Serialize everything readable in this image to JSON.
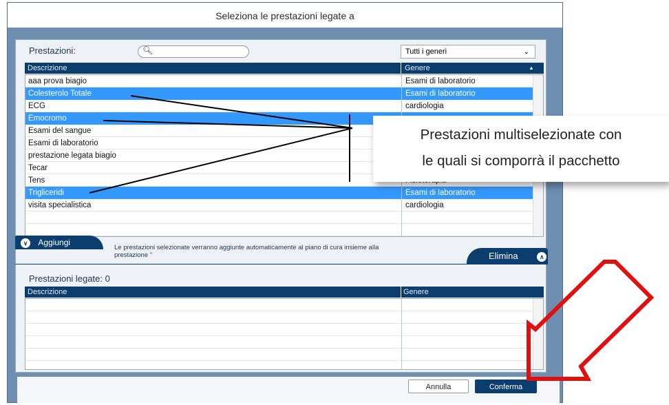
{
  "window": {
    "title": "Seleziona le prestazioni legate a"
  },
  "top": {
    "label": "Prestazioni:",
    "search_value": "",
    "filter_value": "Tutti i generi",
    "columns": [
      "Descrizione",
      "Genere"
    ],
    "sort_indicator": "▲",
    "rows": [
      {
        "descrizione": "aaa prova biagio",
        "genere": "Esami di laboratorio",
        "selected": false
      },
      {
        "descrizione": "Colesterolo Totale",
        "genere": "Esami di laboratorio",
        "selected": true
      },
      {
        "descrizione": "ECG",
        "genere": "cardiologia",
        "selected": false
      },
      {
        "descrizione": "Emocromo",
        "genere": "",
        "selected": true
      },
      {
        "descrizione": "Esami del sangue",
        "genere": "",
        "selected": false
      },
      {
        "descrizione": "Esami di laboratorio",
        "genere": "",
        "selected": false
      },
      {
        "descrizione": "prestazione legata biagio",
        "genere": "",
        "selected": false
      },
      {
        "descrizione": "Tecar",
        "genere": "",
        "selected": false
      },
      {
        "descrizione": "Tens",
        "genere": "Fisioterapia",
        "selected": false
      },
      {
        "descrizione": "Trigliceridi",
        "genere": "Esami di laboratorio",
        "selected": true
      },
      {
        "descrizione": "visita specialistica",
        "genere": "cardiologia",
        "selected": false
      }
    ]
  },
  "middle": {
    "aggiungi_label": "Aggiungi",
    "info_line1": "Le prestazioni selezionate verranno aggiunte automaticamente al piano di cura insieme alla",
    "info_line2": "prestazione ''",
    "elimina_label": "Elimina"
  },
  "bottom": {
    "label": "Prestazioni legate: 0",
    "columns": [
      "Descrizione",
      "Genere"
    ]
  },
  "buttons": {
    "annulla": "Annulla",
    "conferma": "Conferma"
  },
  "callout": {
    "line1": "Prestazioni multiselezionate con",
    "line2": "le quali si comporrà il pacchetto"
  },
  "colors": {
    "header": "#0b3d6e",
    "selection": "#3399ff",
    "arrow": "#e01010",
    "frame": "#6f8fb1"
  },
  "icons": [
    "search-icon",
    "chevron-down-icon",
    "sort-up-icon",
    "expand-down-icon",
    "collapse-up-icon",
    "red-arrow"
  ]
}
